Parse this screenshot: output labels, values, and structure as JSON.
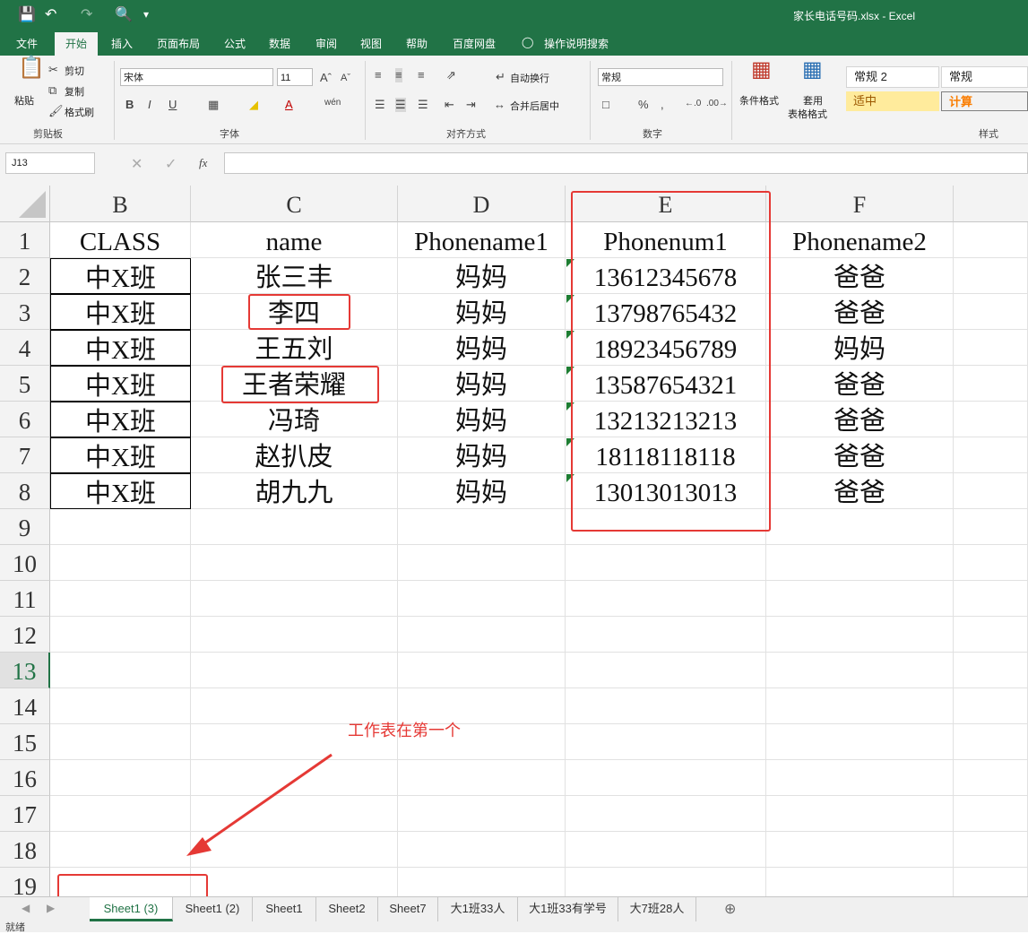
{
  "window": {
    "title": "家长电话号码.xlsx  -  Excel"
  },
  "ribbon_tabs": [
    "文件",
    "开始",
    "插入",
    "页面布局",
    "公式",
    "数据",
    "审阅",
    "视图",
    "帮助",
    "百度网盘",
    "操作说明搜索"
  ],
  "ribbon": {
    "clipboard": {
      "paste": "粘贴",
      "cut": "剪切",
      "copy": "复制",
      "format_painter": "格式刷",
      "label": "剪贴板"
    },
    "font": {
      "name": "宋体",
      "size": "11",
      "label": "字体"
    },
    "alignment": {
      "wrap": "自动换行",
      "merge": "合并后居中",
      "label": "对齐方式"
    },
    "number": {
      "format": "常规",
      "label": "数字"
    },
    "styles": {
      "cond_format": "条件格式",
      "table_format_1": "套用",
      "table_format_2": "表格格式",
      "normal2": "常规 2",
      "normal": "常规",
      "neutral": "适中",
      "calc": "计算",
      "label": "样式"
    }
  },
  "formula_bar": {
    "namebox": "J13",
    "fx": "fx",
    "value": ""
  },
  "columns": [
    "B",
    "C",
    "D",
    "E",
    "F"
  ],
  "rows": [
    "1",
    "2",
    "3",
    "4",
    "5",
    "6",
    "7",
    "8",
    "9",
    "10",
    "11",
    "12",
    "13",
    "14",
    "15",
    "16",
    "17",
    "18",
    "19"
  ],
  "table": [
    [
      "CLASS",
      "name",
      "Phonename1",
      "Phonenum1",
      "Phonename2"
    ],
    [
      "中X班",
      "张三丰",
      "妈妈",
      "13612345678",
      "爸爸"
    ],
    [
      "中X班",
      "李四",
      "妈妈",
      "13798765432",
      "爸爸"
    ],
    [
      "中X班",
      "王五刘",
      "妈妈",
      "18923456789",
      "妈妈"
    ],
    [
      "中X班",
      "王者荣耀",
      "妈妈",
      "13587654321",
      "爸爸"
    ],
    [
      "中X班",
      "冯琦",
      "妈妈",
      "13213213213",
      "爸爸"
    ],
    [
      "中X班",
      "赵扒皮",
      "妈妈",
      "18118118118",
      "爸爸"
    ],
    [
      "中X班",
      "胡九九",
      "妈妈",
      "13013013013",
      "爸爸"
    ]
  ],
  "annotation": "工作表在第一个",
  "sheet_tabs": [
    "Sheet1 (3)",
    "Sheet1 (2)",
    "Sheet1",
    "Sheet2",
    "Sheet7",
    "大1班33人",
    "大1班33有学号",
    "大7班28人"
  ],
  "status": "就绪",
  "colors": {
    "excel_green": "#217346",
    "annotation_red": "#e53935",
    "neutral_bg": "#ffeb9c",
    "calc_bg": "#f2f2f2"
  }
}
